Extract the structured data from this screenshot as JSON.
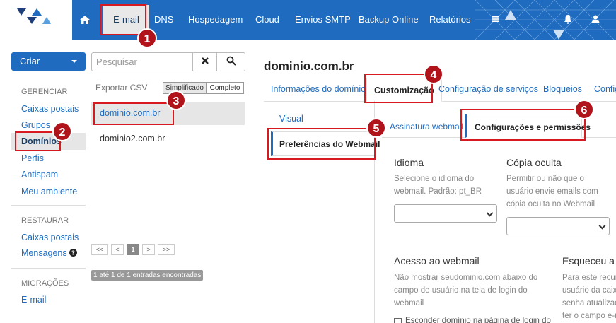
{
  "topnav": {
    "items": [
      {
        "label": "E-mail",
        "active": true
      },
      {
        "label": "DNS"
      },
      {
        "label": "Hospedagem"
      },
      {
        "label": "Cloud"
      },
      {
        "label": "Envios SMTP"
      },
      {
        "label": "Backup Online"
      },
      {
        "label": "Relatórios"
      }
    ],
    "icons": [
      "home-icon",
      "menu-icon",
      "bell-icon",
      "user-icon"
    ],
    "bar_color": "#1e6bbf"
  },
  "sidebar": {
    "create_button": "Criar",
    "gerenciar": {
      "title": "GERENCIAR",
      "items": [
        "Caixas postais",
        "Grupos",
        "Domínios",
        "Perfis",
        "Antispam",
        "Meu ambiente"
      ]
    },
    "restaurar": {
      "title": "RESTAURAR",
      "items": [
        "Caixas postais",
        "Mensagens"
      ]
    },
    "migracoes": {
      "title": "MIGRAÇÕES",
      "items": [
        "E-mail"
      ]
    }
  },
  "list_panel": {
    "search_placeholder": "Pesquisar",
    "export": "Exportar CSV",
    "view_simple": "Simplificado",
    "view_full": "Completo",
    "domains": [
      "dominio.com.br",
      "dominio2.com.br"
    ],
    "pagination": [
      "<<",
      "<",
      "1",
      ">",
      ">>"
    ],
    "summary": "1 até 1 de 1 entradas encontradas"
  },
  "detail": {
    "title": "dominio.com.br",
    "tabs": [
      "Informações do domínio",
      "Customização",
      "Configuração de serviços",
      "Bloqueios",
      "Configu"
    ],
    "vertical_tabs": [
      "Visual",
      "Preferências do Webmail"
    ],
    "subtabs": [
      "Assinatura webmail",
      "Configurações e permissões"
    ],
    "fields": {
      "idioma": {
        "label": "Idioma",
        "help": [
          "Selecione o idioma do",
          "webmail. Padrão: pt_BR"
        ]
      },
      "copia": {
        "label": "Cópia oculta",
        "help": [
          "Permitir ou não que o",
          "usuário envie emails com",
          "cópia oculta no Webmail"
        ]
      },
      "acesso": {
        "label": "Acesso ao webmail",
        "help": [
          "Não mostrar seudominio.com abaixo do",
          "campo de usuário na tela de login do",
          "webmail"
        ],
        "checkbox": "Esconder domínio na página de login do"
      },
      "esqueceu": {
        "label": "Esqueceu a s",
        "help": [
          "Para este recur",
          "usuário da caix",
          "senha atualizad",
          "ter o campo e-m"
        ]
      }
    }
  },
  "callouts": [
    "1",
    "2",
    "3",
    "4",
    "5",
    "6"
  ],
  "colors": {
    "callout": "#d71920",
    "badge": "#b0131a",
    "accent": "#1e6bbf"
  }
}
